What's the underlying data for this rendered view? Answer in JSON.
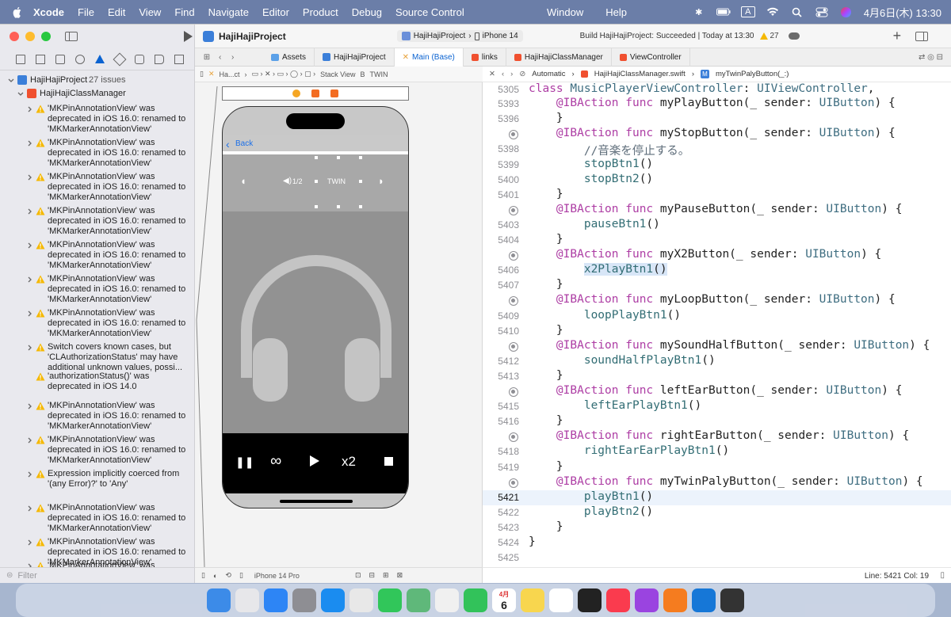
{
  "menubar": {
    "app_name": "Xcode",
    "items": [
      "File",
      "Edit",
      "View",
      "Find",
      "Navigate",
      "Editor",
      "Product",
      "Debug",
      "Source Control"
    ],
    "right_items": [
      "Window",
      "Help"
    ],
    "input_mode": "A",
    "datetime": "4月6日(木) 13:30"
  },
  "toolbar": {
    "project_name": "HajiHajiProject",
    "scheme": "HajiHajiProject",
    "device": "iPhone 14",
    "build_status": "Build HajiHajiProject: Succeeded | Today at 13:30",
    "warning_count": "27"
  },
  "navigator": {
    "project_label": "HajiHajiProject",
    "project_issues": "27 issues",
    "group_label": "HajiHajiClassManager",
    "issues": [
      "'MKPinAnnotationView' was deprecated in iOS 16.0: renamed to 'MKMarkerAnnotationView'",
      "'MKPinAnnotationView' was deprecated in iOS 16.0: renamed to 'MKMarkerAnnotationView'",
      "'MKPinAnnotationView' was deprecated in iOS 16.0: renamed to 'MKMarkerAnnotationView'",
      "'MKPinAnnotationView' was deprecated in iOS 16.0: renamed to 'MKMarkerAnnotationView'",
      "'MKPinAnnotationView' was deprecated in iOS 16.0: renamed to 'MKMarkerAnnotationView'",
      "'MKPinAnnotationView' was deprecated in iOS 16.0: renamed to 'MKMarkerAnnotationView'",
      "'MKPinAnnotationView' was deprecated in iOS 16.0: renamed to 'MKMarkerAnnotationView'",
      "Switch covers known cases, but 'CLAuthorizationStatus' may have additional unknown values, possi...",
      "'authorizationStatus()' was deprecated in iOS 14.0",
      "'MKPinAnnotationView' was deprecated in iOS 16.0: renamed to 'MKMarkerAnnotationView'",
      "'MKPinAnnotationView' was deprecated in iOS 16.0: renamed to 'MKMarkerAnnotationView'",
      "Expression implicitly coerced from '(any Error)?' to 'Any'",
      "'MKPinAnnotationView' was deprecated in iOS 16.0: renamed to 'MKMarkerAnnotationView'",
      "'MKPinAnnotationView' was deprecated in iOS 16.0: renamed to 'MKMarkerAnnotationView'",
      "'MKPinAnnotationView' was"
    ],
    "filter_placeholder": "Filter"
  },
  "tabs": [
    "Assets",
    "HajiHajiProject",
    "Main (Base)",
    "links",
    "HajiHajiClassManager",
    "ViewController"
  ],
  "ib": {
    "jumpbar": [
      "Ha...ct",
      "Stack View",
      "B",
      "TWIN"
    ],
    "back_label": "Back",
    "half_label": "1/2",
    "twin_label": "TWIN",
    "x2_label": "x2",
    "device_label": "iPhone 14 Pro"
  },
  "editor": {
    "jumpbar": [
      "Automatic",
      "HajiHajiClassManager.swift",
      "myTwinPalyButton(_:)"
    ],
    "status": "Line: 5421  Col: 19",
    "lines": [
      {
        "n": "5305",
        "t": "class MusicPlayerViewController: UIViewController,",
        "bp": false
      },
      {
        "n": "5393",
        "t": "    @IBAction func myPlayButton(_ sender: UIButton) {",
        "bp": false
      },
      {
        "n": "5396",
        "t": "    }",
        "bp": false
      },
      {
        "n": "",
        "t": "    @IBAction func myStopButton(_ sender: UIButton) {",
        "bp": true
      },
      {
        "n": "5398",
        "t": "        //音楽を停止する。",
        "bp": false
      },
      {
        "n": "5399",
        "t": "        stopBtn1()",
        "bp": false
      },
      {
        "n": "5400",
        "t": "        stopBtn2()",
        "bp": false
      },
      {
        "n": "5401",
        "t": "    }",
        "bp": false
      },
      {
        "n": "",
        "t": "    @IBAction func myPauseButton(_ sender: UIButton) {",
        "bp": true
      },
      {
        "n": "5403",
        "t": "        pauseBtn1()",
        "bp": false
      },
      {
        "n": "5404",
        "t": "    }",
        "bp": false
      },
      {
        "n": "",
        "t": "    @IBAction func myX2Button(_ sender: UIButton) {",
        "bp": true
      },
      {
        "n": "5406",
        "t": "        x2PlayBtn1()",
        "bp": false
      },
      {
        "n": "5407",
        "t": "    }",
        "bp": false
      },
      {
        "n": "",
        "t": "    @IBAction func myLoopButton(_ sender: UIButton) {",
        "bp": true
      },
      {
        "n": "5409",
        "t": "        loopPlayBtn1()",
        "bp": false
      },
      {
        "n": "5410",
        "t": "    }",
        "bp": false
      },
      {
        "n": "",
        "t": "    @IBAction func mySoundHalfButton(_ sender: UIButton) {",
        "bp": true
      },
      {
        "n": "5412",
        "t": "        soundHalfPlayBtn1()",
        "bp": false
      },
      {
        "n": "5413",
        "t": "    }",
        "bp": false
      },
      {
        "n": "",
        "t": "    @IBAction func leftEarButton(_ sender: UIButton) {",
        "bp": true
      },
      {
        "n": "5415",
        "t": "        leftEarPlayBtn1()",
        "bp": false
      },
      {
        "n": "5416",
        "t": "    }",
        "bp": false
      },
      {
        "n": "",
        "t": "    @IBAction func rightEarButton(_ sender: UIButton) {",
        "bp": true
      },
      {
        "n": "5418",
        "t": "        rightEarEarPlayBtn1()",
        "bp": false
      },
      {
        "n": "5419",
        "t": "    }",
        "bp": false
      },
      {
        "n": "",
        "t": "    @IBAction func myTwinPalyButton(_ sender: UIButton) {",
        "bp": true
      },
      {
        "n": "5421",
        "t": "        playBtn1()",
        "bp": false
      },
      {
        "n": "5422",
        "t": "        playBtn2()",
        "bp": false
      },
      {
        "n": "5423",
        "t": "    }",
        "bp": false
      },
      {
        "n": "5424",
        "t": "}",
        "bp": false
      },
      {
        "n": "5425",
        "t": "",
        "bp": false
      }
    ]
  },
  "dock": {
    "calendar_month": "4月",
    "calendar_day": "6",
    "apps": [
      "finder-icon",
      "launchpad-icon",
      "mail-icon",
      "settings-icon",
      "safari-icon",
      "chrome-icon",
      "messages-icon",
      "maps-icon",
      "photos-icon",
      "facetime-icon",
      "calendar-icon",
      "notes-icon",
      "reminders-icon",
      "appletv-icon",
      "music-icon",
      "podcasts-icon",
      "books-icon",
      "xcode-icon",
      "terminal-icon"
    ]
  }
}
